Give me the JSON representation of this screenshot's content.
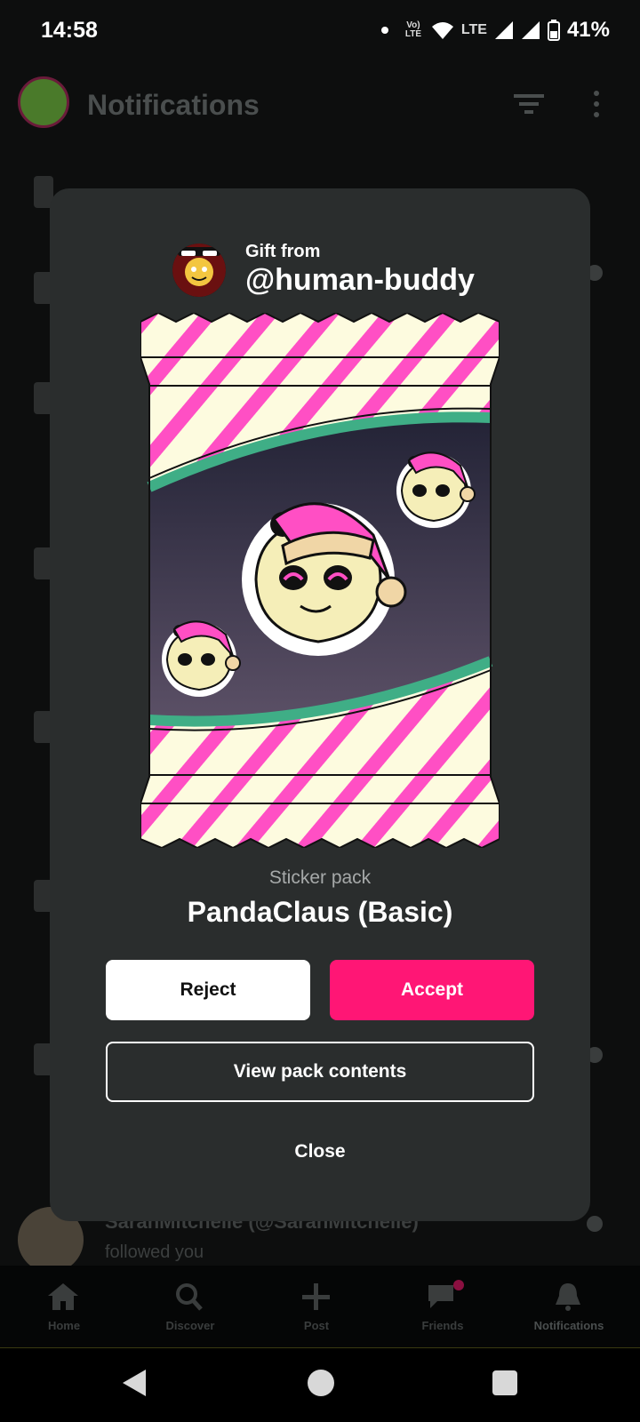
{
  "status_bar": {
    "time": "14:58",
    "volte_label": "Vo) LTE",
    "network_label": "LTE",
    "battery_percent": "41%"
  },
  "background": {
    "header_title": "Notifications",
    "last_row_text": "SarahMitchelle (@SarahMitchelle)",
    "last_row_sub": "followed you",
    "nav": [
      {
        "label": "Home",
        "icon": "home-icon"
      },
      {
        "label": "Discover",
        "icon": "search-icon"
      },
      {
        "label": "Post",
        "icon": "plus-icon"
      },
      {
        "label": "Friends",
        "icon": "chat-icon"
      },
      {
        "label": "Notifications",
        "icon": "bell-icon"
      }
    ]
  },
  "gift_modal": {
    "gift_label": "Gift from",
    "sender_handle": "@human-buddy",
    "pack_kind": "Sticker pack",
    "pack_name": "PandaClaus (Basic)",
    "reject_label": "Reject",
    "accept_label": "Accept",
    "view_label": "View pack contents",
    "close_label": "Close"
  },
  "colors": {
    "accent": "#ff1675",
    "modal_bg": "#2a2d2d",
    "wrapper_cream": "#fdfbdf",
    "wrapper_stripe": "#ff4fc4",
    "window_green": "#3fae86"
  }
}
